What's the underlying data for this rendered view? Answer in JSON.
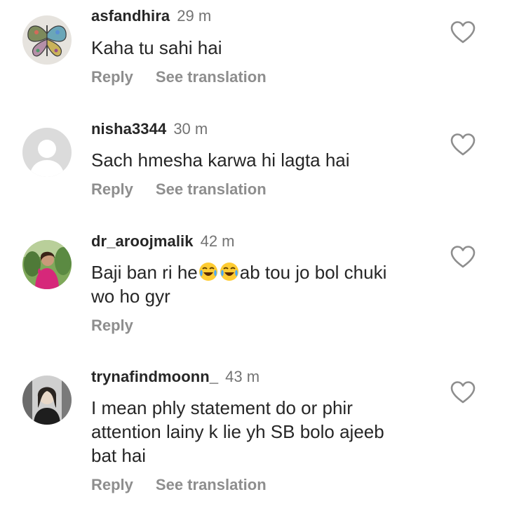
{
  "comments": [
    {
      "username": "asfandhira",
      "time": "29 m",
      "text": "Kaha tu sahi hai",
      "reply_label": "Reply",
      "translate_label": "See translation",
      "avatar_icon": "butterfly-avatar-icon"
    },
    {
      "username": "nisha3344",
      "time": "30 m",
      "text": "Sach hmesha karwa hi lagta hai",
      "reply_label": "Reply",
      "translate_label": "See translation",
      "avatar_icon": "default-user-avatar-icon"
    },
    {
      "username": "dr_aroojmalik",
      "time": "42 m",
      "text_before": "Baji ban ri he",
      "emoji": "face-with-tears-of-joy",
      "text_after": "ab tou jo bol chuki",
      "text_line2": "wo ho gyr",
      "reply_label": "Reply",
      "avatar_icon": "photo-avatar-icon"
    },
    {
      "username": "trynafindmoonn_",
      "time": "43 m",
      "text_line1": "I mean phly statement do or phir",
      "text_line2": "attention lainy k lie yh SB bolo ajeeb",
      "text_line3": "bat hai",
      "reply_label": "Reply",
      "translate_label": "See translation",
      "avatar_icon": "photo-avatar-icon"
    }
  ],
  "colors": {
    "username": "#262626",
    "time": "#737373",
    "action": "#8e8e8e",
    "heart_outline": "#8e8e8e"
  },
  "icons": {
    "like": "heart-outline-icon"
  }
}
